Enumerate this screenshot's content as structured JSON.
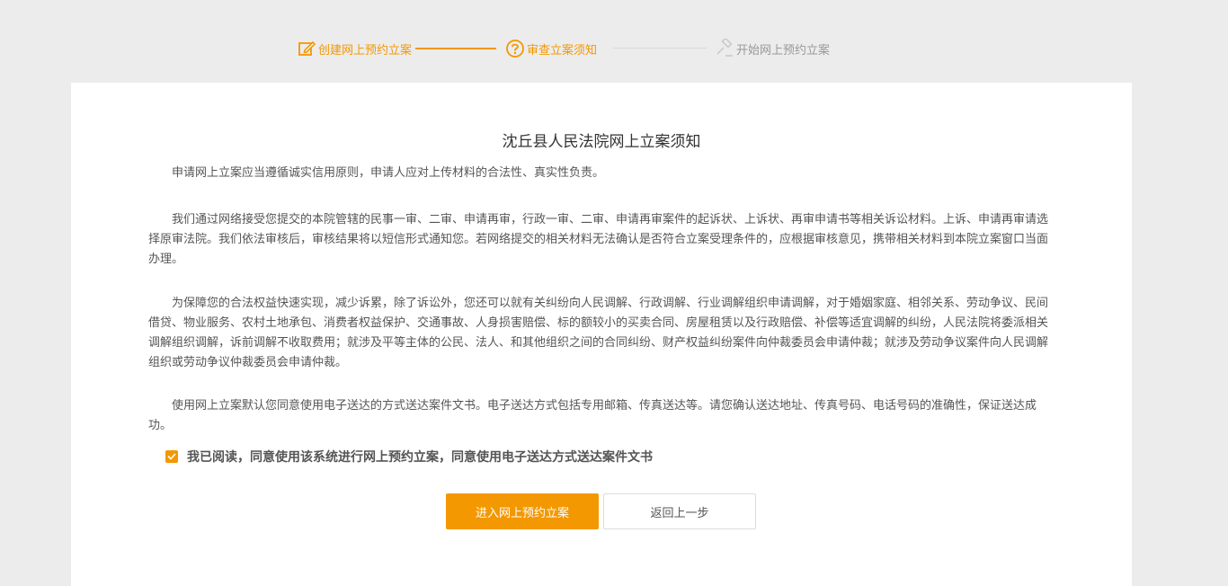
{
  "steps": [
    {
      "label": "创建网上预约立案",
      "state": "done",
      "icon": "edit-icon"
    },
    {
      "label": "审查立案须知",
      "state": "active",
      "icon": "question-circle-icon"
    },
    {
      "label": "开始网上预约立案",
      "state": "pending",
      "icon": "gavel-icon"
    }
  ],
  "colors": {
    "accent": "#f39800",
    "background": "#ececec",
    "card": "#ffffff",
    "inactive": "#999999"
  },
  "notice": {
    "title": "沈丘县人民法院网上立案须知",
    "paragraphs": [
      "申请网上立案应当遵循诚实信用原则，申请人应对上传材料的合法性、真实性负责。",
      "我们通过网络接受您提交的本院管辖的民事一审、二审、申请再审，行政一审、二审、申请再审案件的起诉状、上诉状、再审申请书等相关诉讼材料。上诉、申请再审请选择原审法院。我们依法审核后，审核结果将以短信形式通知您。若网络提交的相关材料无法确认是否符合立案受理条件的，应根据审核意见，携带相关材料到本院立案窗口当面办理。",
      "为保障您的合法权益快速实现，减少诉累，除了诉讼外，您还可以就有关纠纷向人民调解、行政调解、行业调解组织申请调解，对于婚姻家庭、相邻关系、劳动争议、民间借贷、物业服务、农村土地承包、消费者权益保护、交通事故、人身损害赔偿、标的额较小的买卖合同、房屋租赁以及行政赔偿、补偿等适宜调解的纠纷，人民法院将委派相关调解组织调解，诉前调解不收取费用；就涉及平等主体的公民、法人、和其他组织之间的合同纠纷、财产权益纠纷案件向仲裁委员会申请仲裁；就涉及劳动争议案件向人民调解组织或劳动争议仲裁委员会申请仲裁。",
      "使用网上立案默认您同意使用电子送达的方式送达案件文书。电子送达方式包括专用邮箱、传真送达等。请您确认送达地址、传真号码、电话号码的准确性，保证送达成功。"
    ]
  },
  "agreement": {
    "checked": true,
    "label": "我已阅读，同意使用该系统进行网上预约立案，同意使用电子送达方式送达案件文书"
  },
  "buttons": {
    "primary": "进入网上预约立案",
    "secondary": "返回上一步"
  }
}
